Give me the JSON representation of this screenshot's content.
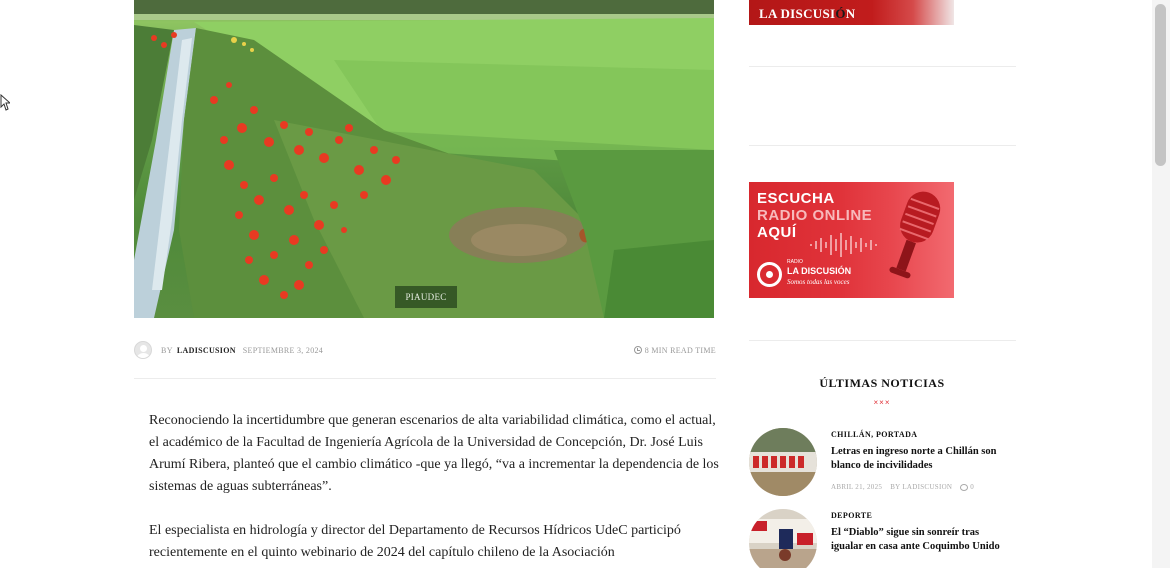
{
  "hero": {
    "photo_credit": "PIAUDEC"
  },
  "article_meta": {
    "by": "BY",
    "author": "LADISCUSION",
    "date": "SEPTIEMBRE 3, 2024",
    "read_time": "8 MIN READ TIME"
  },
  "article": {
    "paragraphs": [
      "Reconociendo la incertidumbre que generan escenarios de alta variabilidad climática, como el actual, el académico de la Facultad de Ingeniería Agrícola de la Universidad de Concepción, Dr. José Luis Arumí Ribera, planteó que el cambio climático -que ya llegó, “va a incrementar la dependencia de los sistemas de aguas subterráneas”.",
      "El especialista en hidrología y director del Departamento de Recursos Hídricos UdeC participó recientemente en el quinto webinario de 2024 del capítulo chileno de la Asociación"
    ]
  },
  "sidebar": {
    "logo_banner": {
      "text_main": "LA DISCUSI",
      "text_accent": "Ó",
      "text_end": "N"
    },
    "radio_banner": {
      "line1": "ESCUCHA",
      "line2": "RADIO ONLINE",
      "line3": "AQUÍ",
      "small": "RADIO",
      "name": "LA DISCUSIÓN",
      "slogan": "Somos todas las voces"
    },
    "latest": {
      "title": "ÚLTIMAS NOTICIAS",
      "dots": "×××",
      "items": [
        {
          "category": "CHILLÁN, PORTADA",
          "headline": "Letras en ingreso norte a Chillán son blanco de incivilidades",
          "date": "ABRIL 21, 2025",
          "by": "BY LADISCUSION",
          "comments": "0"
        },
        {
          "category": "DEPORTE",
          "headline": "El “Diablo” sigue sin sonreír tras igualar en casa ante Coquimbo Unido"
        }
      ]
    }
  },
  "colors": {
    "brand_red": "#c11c1c",
    "radio_red": "#e0333a",
    "text": "#222222"
  }
}
